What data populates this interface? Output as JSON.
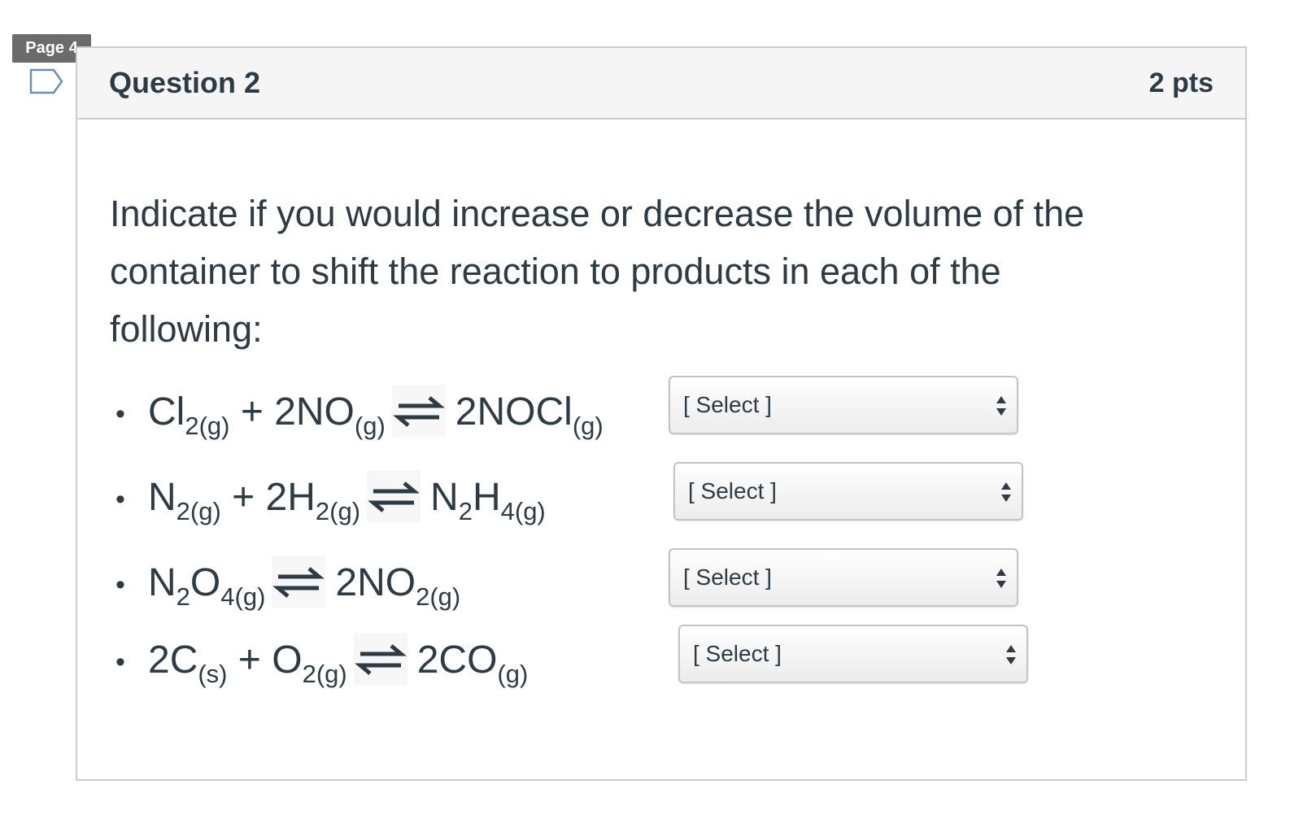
{
  "page_tab": {
    "label": "Page 4"
  },
  "question": {
    "title": "Question 2",
    "points": "2 pts",
    "text": "Indicate if you would increase or decrease the volume of the container to shift the reaction to products in each of the following:"
  },
  "bullet": "•",
  "reactions": [
    {
      "parts": {
        "r1": "Cl",
        "r1_sub": "2(g)",
        "plus": "+",
        "r2": "2NO",
        "r2_sub": "(g)",
        "p1": "2NOCl",
        "p1_sub": "(g)"
      },
      "select": {
        "value": "[ Select ]"
      }
    },
    {
      "parts": {
        "r1": "N",
        "r1_sub": "2(g)",
        "plus": "+",
        "r2": "2H",
        "r2_sub": "2(g)",
        "p1a": "N",
        "p1a_sub": "2",
        "p1b": "H",
        "p1b_sub": "4(g)"
      },
      "select": {
        "value": "[ Select ]"
      }
    },
    {
      "parts": {
        "r1a": "N",
        "r1a_sub": "2",
        "r1b": "O",
        "r1b_sub": "4(g)",
        "p1": "2NO",
        "p1_sub": "2(g)"
      },
      "select": {
        "value": "[ Select ]"
      }
    },
    {
      "parts": {
        "r1": "2C",
        "r1_sub": "(s)",
        "plus": "+",
        "r2": "O",
        "r2_sub": "2(g)",
        "p1": "2CO",
        "p1_sub": "(g)"
      },
      "select": {
        "value": "[ Select ]"
      }
    }
  ],
  "icons": {
    "flag": "bookmark-flag-icon",
    "equilibrium": "equilibrium-arrows-icon",
    "select_caret": "updown-caret-icon"
  },
  "colors": {
    "text": "#2d3b45",
    "header_bg": "#f5f5f5",
    "border": "#c7cdd1",
    "page_tab_bg": "#6b6b6b",
    "flag_stroke": "#6a8fb5"
  }
}
